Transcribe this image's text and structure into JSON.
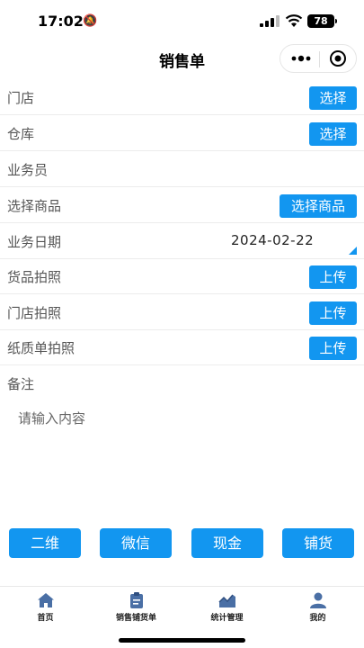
{
  "status_bar": {
    "time": "17:02",
    "battery": "78"
  },
  "nav": {
    "title": "销售单"
  },
  "form": {
    "store_label": "门店",
    "store_button": "选择",
    "warehouse_label": "仓库",
    "warehouse_button": "选择",
    "salesperson_label": "业务员",
    "product_label": "选择商品",
    "product_button": "选择商品",
    "date_label": "业务日期",
    "date_value": "2024-02-22",
    "goods_photo_label": "货品拍照",
    "goods_photo_button": "上传",
    "store_photo_label": "门店拍照",
    "store_photo_button": "上传",
    "paper_photo_label": "纸质单拍照",
    "paper_photo_button": "上传",
    "remarks_label": "备注",
    "remarks_placeholder": "请输入内容"
  },
  "payment_buttons": {
    "qrcode": "二维",
    "wechat": "微信",
    "cash": "现金",
    "stock": "铺货"
  },
  "tabs": [
    {
      "label": "首页",
      "icon": "home-icon"
    },
    {
      "label": "销售铺货单",
      "icon": "clipboard-icon"
    },
    {
      "label": "统计管理",
      "icon": "chart-icon"
    },
    {
      "label": "我的",
      "icon": "user-icon"
    }
  ],
  "colors": {
    "accent": "#1296f0",
    "tab_icon": "#4a6fa5"
  }
}
